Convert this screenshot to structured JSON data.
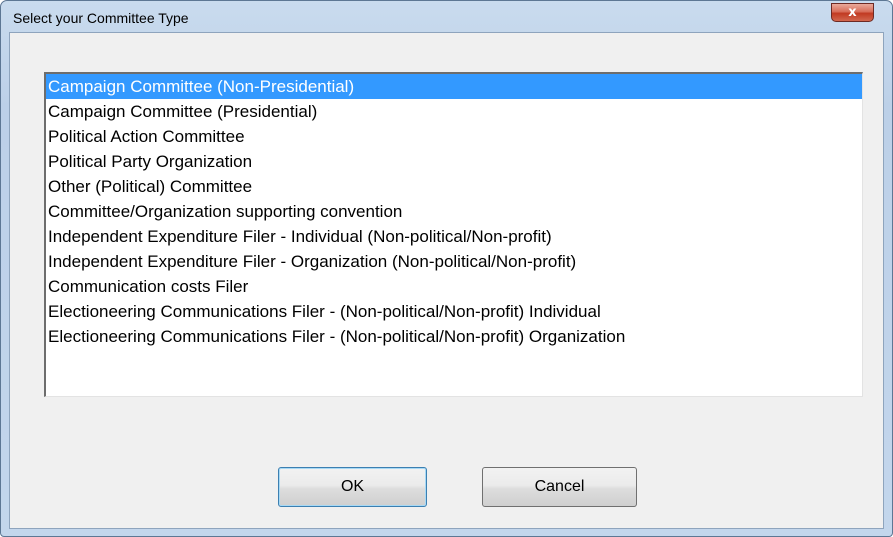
{
  "window": {
    "title": "Select your Committee Type",
    "close_glyph": "x"
  },
  "list": {
    "selected_index": 0,
    "items": [
      "Campaign Committee (Non-Presidential)",
      "Campaign Committee (Presidential)",
      "Political Action Committee",
      "Political Party Organization",
      "Other (Political) Committee",
      "Committee/Organization supporting convention",
      "Independent Expenditure Filer - Individual (Non-political/Non-profit)",
      "Independent Expenditure Filer - Organization (Non-political/Non-profit)",
      "Communication costs Filer",
      "Electioneering Communications Filer - (Non-political/Non-profit) Individual",
      "Electioneering Communications Filer - (Non-political/Non-profit) Organization"
    ]
  },
  "buttons": {
    "ok_label": "OK",
    "cancel_label": "Cancel"
  },
  "colors": {
    "selection": "#3399ff",
    "selection_text": "#ffffff",
    "dialog_background": "#f0f0f0",
    "close_button": "#c13a22"
  },
  "icons": {
    "close": "close-icon"
  }
}
